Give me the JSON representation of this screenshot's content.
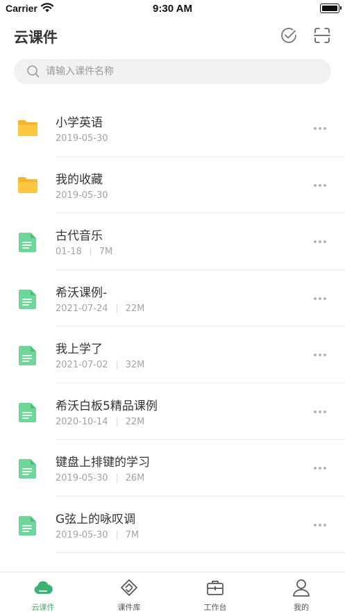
{
  "status_bar": {
    "carrier": "Carrier",
    "time": "9:30 AM"
  },
  "header": {
    "title": "云课件",
    "icons": [
      "check-circle-icon",
      "scan-icon"
    ]
  },
  "search": {
    "placeholder": "请输入课件名称"
  },
  "items": [
    {
      "type": "folder",
      "name": "小学英语",
      "date": "2019-05-30",
      "size": ""
    },
    {
      "type": "folder",
      "name": "我的收藏",
      "date": "2019-05-30",
      "size": ""
    },
    {
      "type": "file",
      "name": "古代音乐",
      "date": "01-18",
      "size": "7M"
    },
    {
      "type": "file",
      "name": "希沃课例-",
      "date": "2021-07-24",
      "size": "22M"
    },
    {
      "type": "file",
      "name": "我上学了",
      "date": "2021-07-02",
      "size": "32M"
    },
    {
      "type": "file",
      "name": "希沃白板5精品课例",
      "date": "2020-10-14",
      "size": "22M"
    },
    {
      "type": "file",
      "name": "键盘上排键的学习",
      "date": "2019-05-30",
      "size": "26M"
    },
    {
      "type": "file",
      "name": "G弦上的咏叹调",
      "date": "2019-05-30",
      "size": "7M"
    }
  ],
  "tabs": [
    {
      "label": "云课件",
      "icon": "cloud-icon",
      "active": true
    },
    {
      "label": "课件库",
      "icon": "library-icon",
      "active": false
    },
    {
      "label": "工作台",
      "icon": "briefcase-icon",
      "active": false
    },
    {
      "label": "我的",
      "icon": "person-icon",
      "active": false
    }
  ],
  "colors": {
    "accent": "#3cb371",
    "folder": "#f7b42c",
    "file": "#6fd69a"
  }
}
